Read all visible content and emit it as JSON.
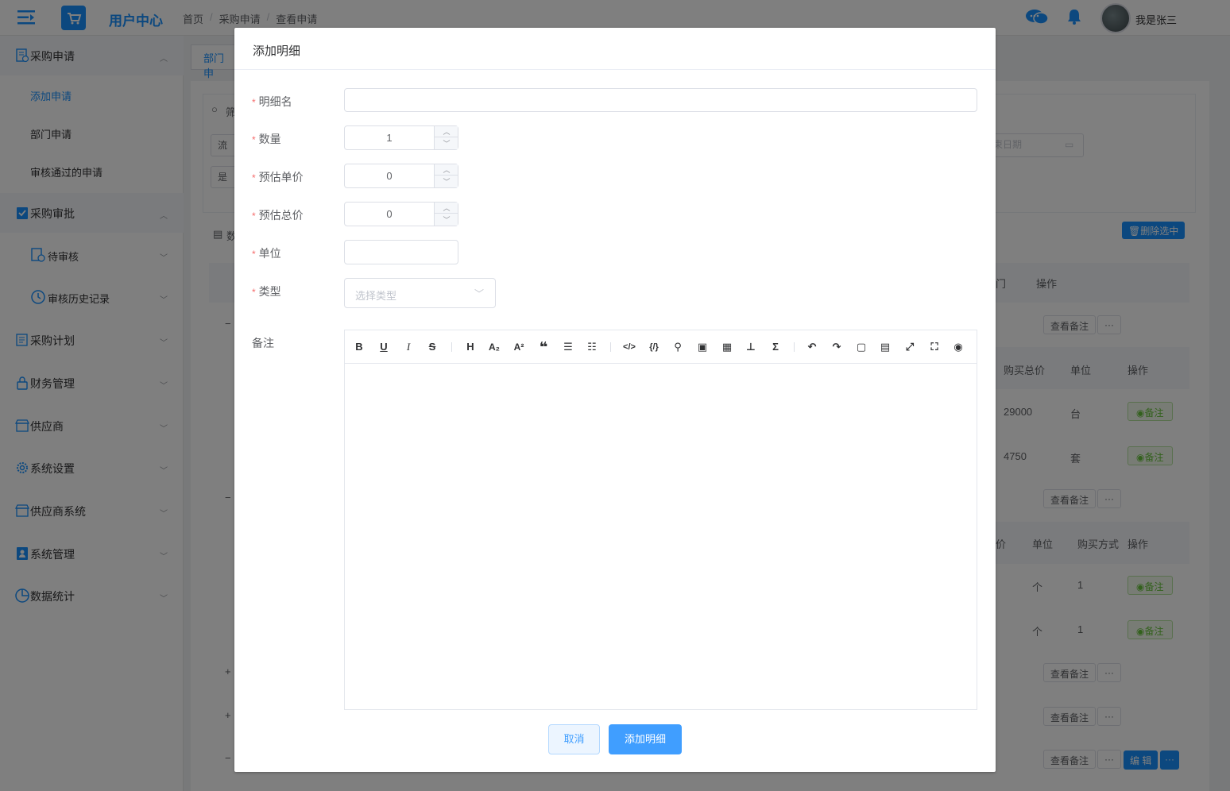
{
  "header": {
    "app_title": "用户中心",
    "breadcrumb": [
      "首页",
      "采购申请",
      "查看申请"
    ],
    "breadcrumb_sep": "/",
    "user_name": "我是张三"
  },
  "sidebar": {
    "groups": [
      {
        "label": "采购申请",
        "icon": "document-icon",
        "open": true
      },
      {
        "label": "采购审批",
        "icon": "clipboard-check-icon",
        "open": true
      },
      {
        "label": "采购计划",
        "icon": "list-icon"
      },
      {
        "label": "财务管理",
        "icon": "lock-icon"
      },
      {
        "label": "供应商",
        "icon": "shop-icon"
      },
      {
        "label": "系统设置",
        "icon": "gear-icon"
      },
      {
        "label": "供应商系统",
        "icon": "shop-icon"
      },
      {
        "label": "系统管理",
        "icon": "admin-icon"
      },
      {
        "label": "数据统计",
        "icon": "pie-chart-icon"
      }
    ],
    "sub_items": [
      "添加申请",
      "部门申请",
      "审核通过的申请"
    ],
    "approval_sub": [
      "待审核",
      "审核历史记录"
    ]
  },
  "background": {
    "tab_label": "部门申",
    "filter_prefix": "筛",
    "flow_prefix": "流",
    "yesno_prefix": "是",
    "data_prefix": "数",
    "date_placeholder": "束日期",
    "delete_selected": "删除选中",
    "col_op": "操作",
    "col_dept_fragment": "门",
    "col_total": "购买总价",
    "col_unit": "单位",
    "col_price_fragment": "价",
    "col_method": "购买方式",
    "view_remark": "查看备注",
    "more": "···",
    "remark": "备注",
    "edit": "编 辑",
    "rows1": [
      {
        "total": "29000",
        "unit": "台"
      },
      {
        "total": "4750",
        "unit": "套"
      }
    ],
    "rows2": [
      {
        "unit": "个",
        "method": "1"
      },
      {
        "unit": "个",
        "method": "1"
      }
    ],
    "minus": "−",
    "plus": "+"
  },
  "dialog": {
    "title": "添加明细",
    "fields": {
      "name_label": "明细名",
      "name_value": "",
      "qty_label": "数量",
      "qty_value": "1",
      "unit_price_label": "预估单价",
      "unit_price_value": "0",
      "total_price_label": "预估总价",
      "total_price_value": "0",
      "unit_label": "单位",
      "unit_value": "",
      "type_label": "类型",
      "type_placeholder": "选择类型",
      "remark_label": "备注"
    },
    "required_mark": "*",
    "toolbar": [
      "bold-icon",
      "underline-icon",
      "italic-icon",
      "strikethrough-icon",
      "heading-icon",
      "subscript-icon",
      "superscript-icon",
      "quote-icon",
      "bullet-list-icon",
      "ordered-list-icon",
      "code-icon",
      "code-block-icon",
      "link-icon",
      "image-icon",
      "table-icon",
      "mindmap-icon",
      "formula-icon",
      "undo-icon",
      "redo-icon",
      "save-icon",
      "toc-icon",
      "expand-icon",
      "fullscreen-icon",
      "preview-icon"
    ],
    "cancel_label": "取消",
    "submit_label": "添加明细"
  },
  "colors": {
    "primary": "#1890ff",
    "button_primary": "#409eff",
    "required": "#f56c6c",
    "success": "#67c23a",
    "overlay": "rgba(0,0,0,0.5)"
  }
}
